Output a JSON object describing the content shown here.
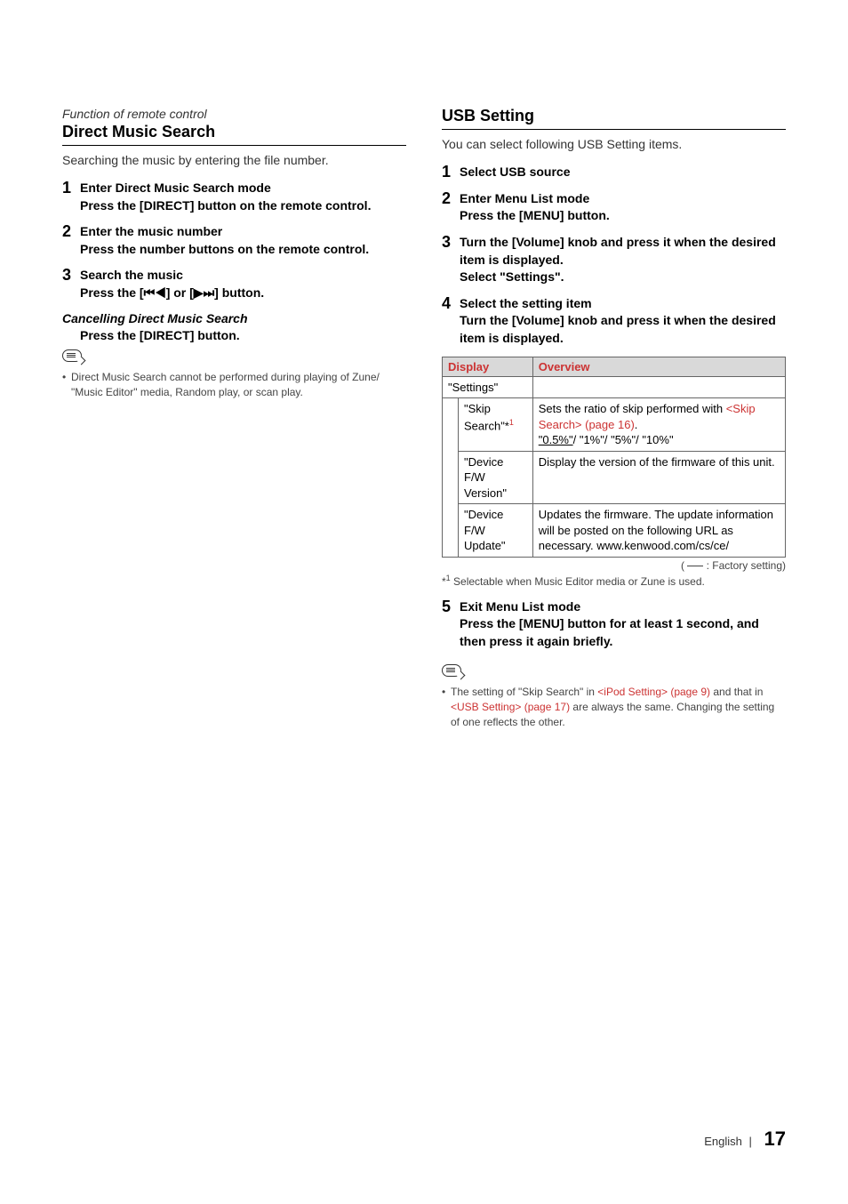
{
  "left": {
    "function_note": "Function of remote control",
    "title": "Direct Music Search",
    "intro": "Searching the music by entering the file number.",
    "steps": [
      {
        "num": "1",
        "title": "Enter Direct Music Search mode",
        "instruction": "Press the [DIRECT] button on the remote control."
      },
      {
        "num": "2",
        "title": "Enter the music number",
        "instruction": "Press the number buttons on the remote control."
      },
      {
        "num": "3",
        "title": "Search the music",
        "instruction_pre": "Press the [",
        "instruction_sym1": "⏮◀",
        "instruction_mid": "] or [",
        "instruction_sym2": "▶⏭",
        "instruction_post": "] button."
      }
    ],
    "cancel_title": "Cancelling Direct Music Search",
    "cancel_instruction": "Press the [DIRECT] button.",
    "note": "Direct Music Search cannot be performed during playing of Zune/ \"Music Editor\" media, Random play, or scan play."
  },
  "right": {
    "title": "USB Setting",
    "intro": "You can select following USB Setting items.",
    "steps_a": [
      {
        "num": "1",
        "title": "Select USB source",
        "instruction": ""
      },
      {
        "num": "2",
        "title": "Enter Menu List mode",
        "instruction": "Press the [MENU] button."
      },
      {
        "num": "3",
        "title": "Turn the [Volume] knob and press it when the desired item is displayed.",
        "instruction": "Select \"Settings\"."
      },
      {
        "num": "4",
        "title": "Select the setting item",
        "instruction": "Turn the [Volume] knob and press it when the desired item is displayed."
      }
    ],
    "table": {
      "head_display": "Display",
      "head_overview": "Overview",
      "settings_label": "\"Settings\"",
      "rows": [
        {
          "display": "\"Skip Search\"*",
          "display_sup": "1",
          "overview_pre": "Sets the ratio of skip performed with ",
          "overview_link": "<Skip Search> (page 16)",
          "overview_post": ".",
          "overview_line2_underline": "\"0.5%\"",
          "overview_line2_rest": "/ \"1%\"/ \"5%\"/ \"10%\""
        },
        {
          "display": "\"Device F/W Version\"",
          "overview": "Display the version of the firmware of this unit."
        },
        {
          "display": "\"Device F/W Update\"",
          "overview": "Updates the firmware. The update information will be posted on the following URL as necessary. www.kenwood.com/cs/ce/"
        }
      ]
    },
    "factory_note_pre": "( ",
    "factory_note_post": " : Factory setting)",
    "footnote_sup": "1",
    "footnote": " Selectable when Music Editor media or Zune is used.",
    "steps_b": [
      {
        "num": "5",
        "title": "Exit Menu List mode",
        "instruction": "Press the [MENU] button for at least 1 second, and then press it again briefly."
      }
    ],
    "note_pre": "The setting of \"Skip Search\" in ",
    "note_link1": "<iPod Setting> (page 9)",
    "note_mid": " and that in ",
    "note_link2": "<USB Setting> (page 17)",
    "note_post": " are always the same. Changing the setting of one reflects the other."
  },
  "footer": {
    "lang": "English",
    "sep": "|",
    "page": "17"
  },
  "chart_data": {
    "type": "table",
    "title": "USB Setting items",
    "columns": [
      "Display",
      "Overview"
    ],
    "rows": [
      [
        "\"Settings\"",
        ""
      ],
      [
        "\"Skip Search\"*1",
        "Sets the ratio of skip performed with <Skip Search> (page 16). \"0.5%\"/\"1%\"/\"5%\"/\"10%\" (default 0.5%)"
      ],
      [
        "\"Device F/W Version\"",
        "Display the version of the firmware of this unit."
      ],
      [
        "\"Device F/W Update\"",
        "Updates the firmware. The update information will be posted on the following URL as necessary. www.kenwood.com/cs/ce/"
      ]
    ]
  }
}
